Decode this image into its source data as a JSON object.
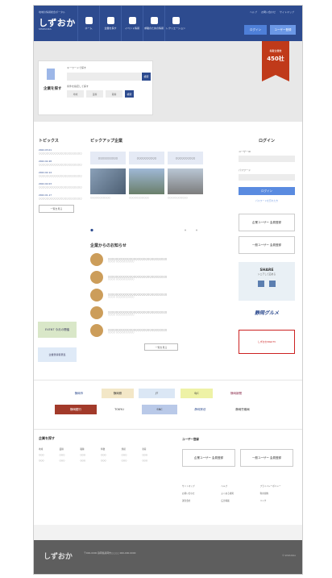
{
  "header": {
    "logo_small": "地域の情報総合ポータル",
    "logo": "しずおか",
    "logo_sub": "SHIZUOKA",
    "nav": [
      {
        "label": "ホーム",
        "icon": "home-icon"
      },
      {
        "label": "企業を探す",
        "icon": "search-icon"
      },
      {
        "label": "イベント情報",
        "icon": "calendar-icon"
      },
      {
        "label": "求職のための情報",
        "icon": "building-icon"
      },
      {
        "label": "レクリエーション",
        "icon": "globe-icon"
      }
    ],
    "top_links": [
      "ヘルプ",
      "お問い合わせ",
      "サイトマップ"
    ],
    "login_label": "ログイン",
    "register_label": "ユーザー登録"
  },
  "hero": {
    "search_title": "企業を探す",
    "keyword_label": "キーワードで探す",
    "keyword_button": "検索",
    "condition_label": "条件を指定して探す",
    "conditions": [
      "地域",
      "業種",
      "職種"
    ],
    "condition_button": "検索",
    "ribbon_small": "掲載企業数",
    "ribbon_big": "450社"
  },
  "topics": {
    "title": "トピックス",
    "items": [
      {
        "date": "2022.03.01",
        "text": "○○○○○○○○○○○○○○○○○○○○○○"
      },
      {
        "date": "2022.02.28",
        "text": "○○○○○○○○○○○○○○○○○○○○○○"
      },
      {
        "date": "2022.02.14",
        "text": "○○○○○○○○○○○○○○○○○○○○○○"
      },
      {
        "date": "2022.02.03",
        "text": "○○○○○○○○○○○○○○○○○○○○○○"
      },
      {
        "date": "2022.01.17",
        "text": "○○○○○○○○○○○○○○○○○○○○○○"
      }
    ],
    "more": "一覧を見る"
  },
  "banners": {
    "green": "EVENT 今月の開催",
    "blue": "企業登録者募集"
  },
  "pickup": {
    "title": "ピックアップ企業",
    "tabs": [
      "○○○○○○○○○○",
      "○○○○○○○○○○",
      "○○○○○○○○○○"
    ],
    "captions": [
      "○○○○○○○○○○○",
      "○○○○○○○○○○○",
      "○○○○○○○○○○○"
    ]
  },
  "notices": {
    "title": "企業からのお知らせ",
    "items": [
      {
        "title": "○○○○○○○○○○○○○○○○○○○○○○○○○○○○○○",
        "meta": "○○○○ ○○○○○○○○○○"
      },
      {
        "title": "○○○○○○○○○○○○○○○○○○○○○○○○○○○○○○",
        "meta": "○○○○ ○○○○○○○○○○"
      },
      {
        "title": "○○○○○○○○○○○○○○○○○○○○○○○○○○○○○○",
        "meta": "○○○○ ○○○○○○○○○○"
      },
      {
        "title": "○○○○○○○○○○○○○○○○○○○○○○○○○○○○○○",
        "meta": "○○○○ ○○○○○○○○○○"
      },
      {
        "title": "○○○○○○○○○○○○○○○○○○○○○○○○○○○○○○",
        "meta": "○○○○ ○○○○○○○○○○"
      }
    ],
    "more": "一覧を見る"
  },
  "login": {
    "title": "ログイン",
    "user_label": "ユーザーID",
    "pass_label": "パスワード",
    "button": "ログイン",
    "forgot": "パスワードを忘れた方"
  },
  "sidebar": {
    "reg1": "企業ユーザー 会員登録",
    "reg2": "一般ユーザー 会員登録",
    "share_title": "SHARE",
    "share_sub": "シェアして広める",
    "goods": "静岡グルメ",
    "tv": "しずおかWebTV"
  },
  "partners": [
    "静岡市",
    "静岡県",
    "JT",
    "SJC",
    "静岡新聞",
    "静岡銀行",
    "TOKYU",
    "SNC",
    "静岡放送",
    "静岡労働局"
  ],
  "footer_links": {
    "title": "企業を探す",
    "cats": [
      "地域",
      "業種",
      "職種",
      "特徴",
      "規模",
      "新着",
      "○○○",
      "○○○",
      "○○○",
      "○○○",
      "○○○",
      "○○○",
      "○○○",
      "○○○",
      "○○○",
      "○○○",
      "○○○",
      "○○○"
    ],
    "members_title": "ユーザー登録",
    "mem1": "企業ユーザー 会員登録",
    "mem2": "一般ユーザー 会員登録",
    "mem_links": [
      "サイトマップ",
      "ヘルプ",
      "プライバシーポリシー",
      "お問い合わせ",
      "よくある質問",
      "利用規約",
      "運営会社",
      "広告掲載",
      "リンク"
    ]
  },
  "footer": {
    "logo": "しずおか",
    "info": "〒000-0000 静岡県静岡市○○○○ 000-000-0000",
    "copy": "© SHIZUOKA"
  }
}
